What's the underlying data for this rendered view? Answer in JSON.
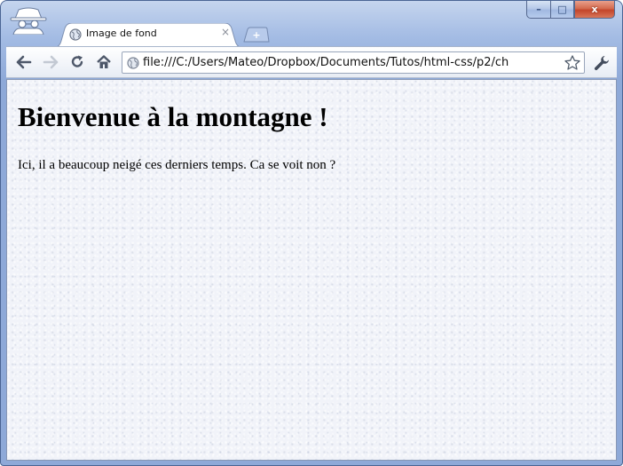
{
  "browser": {
    "tab": {
      "title": "Image de fond",
      "close_glyph": "×"
    },
    "new_tab_glyph": "+",
    "window_controls": {
      "minimize_glyph": "–",
      "maximize_glyph": "□",
      "close_glyph": "x"
    },
    "address_bar": {
      "value": "file:///C:/Users/Mateo/Dropbox/Documents/Tutos/html-css/p2/ch"
    },
    "icons": {
      "incognito": "incognito-spy-icon",
      "favicon": "globe-icon",
      "back": "back-arrow-icon",
      "forward": "forward-arrow-icon",
      "reload": "reload-icon",
      "home": "home-icon",
      "star": "bookmark-star-icon",
      "wrench": "wrench-menu-icon"
    }
  },
  "page": {
    "heading": "Bienvenue à la montagne !",
    "paragraph": "Ici, il a beaucoup neigé ces derniers temps. Ca se voit non ?"
  },
  "colors": {
    "frame": "#a4bce4",
    "close_button": "#c4452b",
    "content_background": "#f1f3f9"
  }
}
